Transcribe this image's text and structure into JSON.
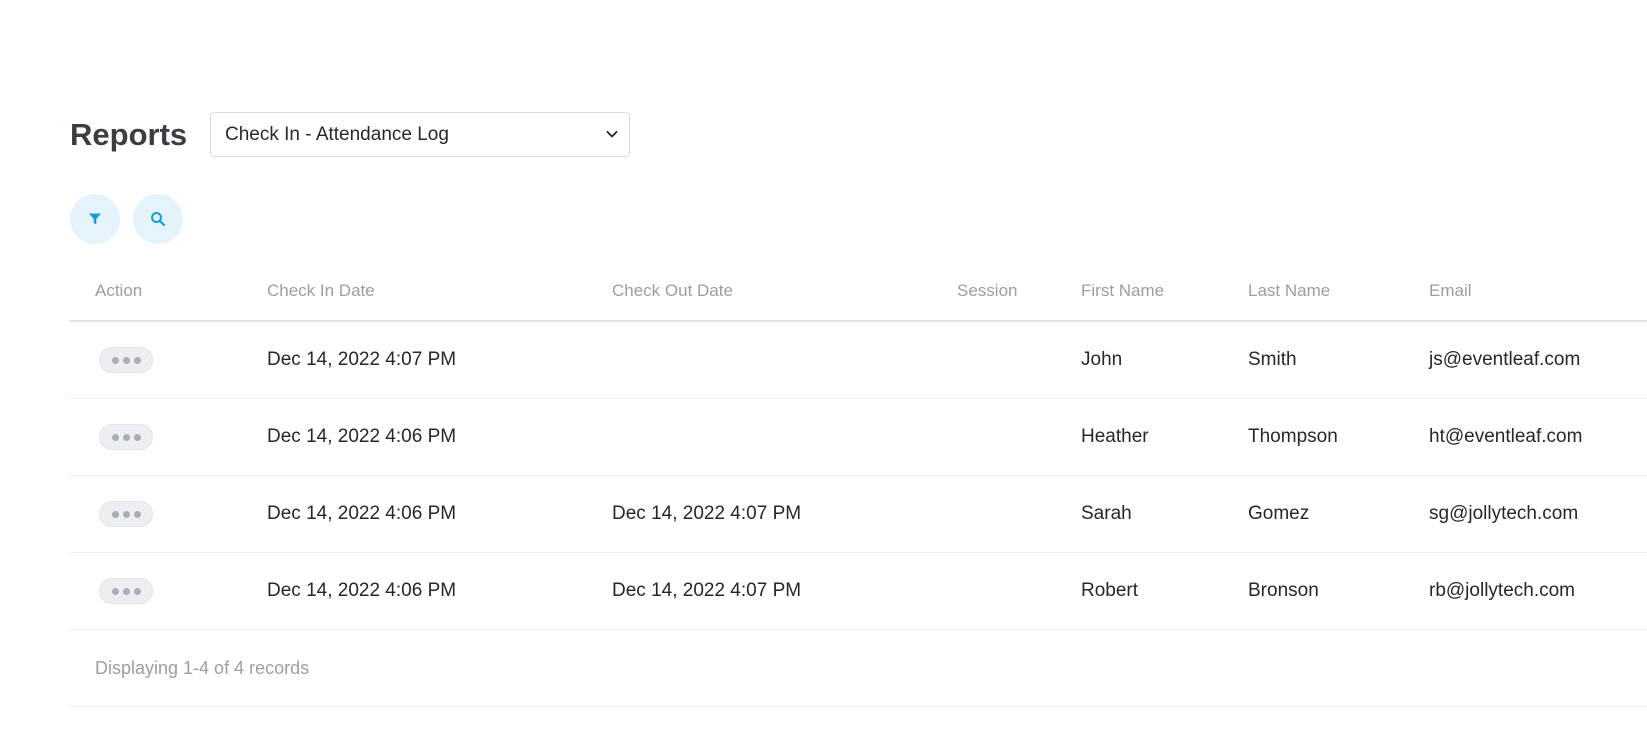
{
  "page": {
    "title": "Reports"
  },
  "report_select": {
    "value": "Check In - Attendance Log"
  },
  "toolbar": {
    "filter_icon": "filter-icon",
    "search_icon": "search-icon"
  },
  "table": {
    "columns": [
      "Action",
      "Check In Date",
      "Check Out Date",
      "Session",
      "First Name",
      "Last Name",
      "Email"
    ],
    "rows": [
      {
        "check_in": "Dec 14, 2022 4:07 PM",
        "check_out": "",
        "session": "",
        "first_name": "John",
        "last_name": "Smith",
        "email": "js@eventleaf.com"
      },
      {
        "check_in": "Dec 14, 2022 4:06 PM",
        "check_out": "",
        "session": "",
        "first_name": "Heather",
        "last_name": "Thompson",
        "email": "ht@eventleaf.com"
      },
      {
        "check_in": "Dec 14, 2022 4:06 PM",
        "check_out": "Dec 14, 2022 4:07 PM",
        "session": "",
        "first_name": "Sarah",
        "last_name": "Gomez",
        "email": "sg@jollytech.com"
      },
      {
        "check_in": "Dec 14, 2022 4:06 PM",
        "check_out": "Dec 14, 2022 4:07 PM",
        "session": "",
        "first_name": "Robert",
        "last_name": "Bronson",
        "email": "rb@jollytech.com"
      }
    ],
    "footer": "Displaying 1-4 of 4 records"
  },
  "colors": {
    "accent": "#1a9ad6",
    "button_bg": "#e5f4fc"
  }
}
